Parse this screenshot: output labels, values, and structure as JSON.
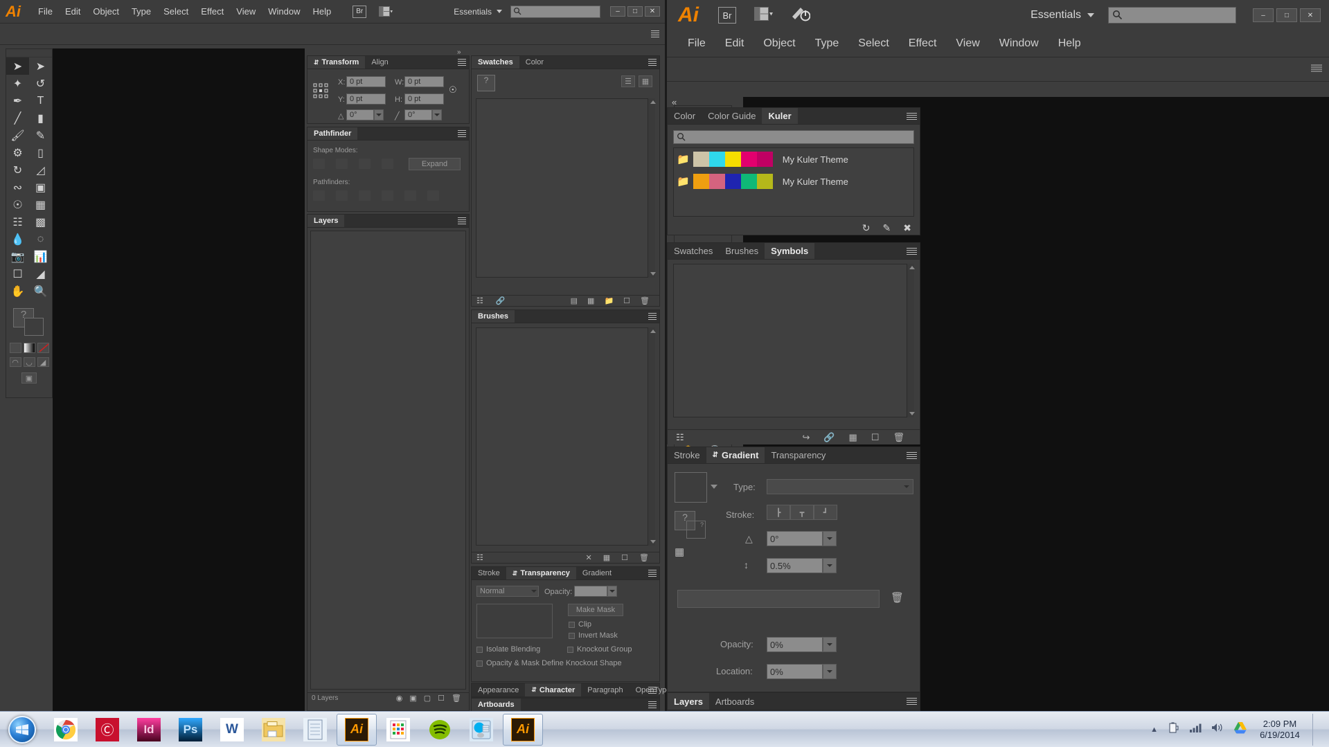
{
  "app": {
    "name": "Adobe Illustrator",
    "logo": "Ai"
  },
  "left_window": {
    "title": "",
    "menus": [
      "File",
      "Edit",
      "Object",
      "Type",
      "Select",
      "Effect",
      "View",
      "Window",
      "Help"
    ],
    "bridge_button": "Br",
    "arrange_icon": "arrange-documents-icon",
    "workspace": "Essentials",
    "search_placeholder": "",
    "window_controls": [
      "minimize",
      "maximize",
      "close"
    ],
    "panels": {
      "transform": {
        "tabs": [
          "Transform",
          "Align"
        ],
        "active_tab": "Transform",
        "fields": [
          {
            "label": "X:",
            "value": "0 pt"
          },
          {
            "label": "Y:",
            "value": "0 pt"
          },
          {
            "label": "W:",
            "value": "0 pt"
          },
          {
            "label": "H:",
            "value": "0 pt"
          }
        ],
        "shear_label": "0°",
        "rotate_label": "0°"
      },
      "pathfinder": {
        "tab": "Pathfinder",
        "shape_modes_label": "Shape Modes:",
        "pathfinders_label": "Pathfinders:",
        "expand_button": "Expand"
      },
      "layers": {
        "tab": "Layers",
        "status": "0 Layers"
      },
      "swatches": {
        "tabs": [
          "Swatches",
          "Color"
        ],
        "active_tab": "Swatches"
      },
      "brushes": {
        "tab": "Brushes"
      },
      "transparency": {
        "tabs": [
          "Stroke",
          "Transparency",
          "Gradient"
        ],
        "active_tab": "Transparency",
        "blend_mode": "Normal",
        "opacity_label": "Opacity:",
        "opacity_value": "",
        "make_mask_button": "Make Mask",
        "clip_label": "Clip",
        "invert_mask_label": "Invert Mask",
        "isolate_blending_label": "Isolate Blending",
        "knockout_group_label": "Knockout Group",
        "knockout_shape_label": "Opacity & Mask Define Knockout Shape"
      },
      "character": {
        "tabs": [
          "Appearance",
          "Character",
          "Paragraph",
          "OpenType"
        ],
        "active_tab": "Character"
      },
      "artboards": {
        "tab": "Artboards"
      }
    }
  },
  "right_window": {
    "menus": [
      "File",
      "Edit",
      "Object",
      "Type",
      "Select",
      "Effect",
      "View",
      "Window",
      "Help"
    ],
    "bridge_button": "Br",
    "arrange_icon": "arrange-documents-icon",
    "rocket_icon": "stock-icon",
    "workspace": "Essentials",
    "search_placeholder": "",
    "window_controls": [
      "minimize",
      "maximize",
      "close"
    ],
    "panels": {
      "kuler": {
        "tabs": [
          "Color",
          "Color Guide",
          "Kuler"
        ],
        "active_tab": "Kuler",
        "search_placeholder": "",
        "themes": [
          {
            "name": "My Kuler Theme",
            "colors": [
              "#cdc4a8",
              "#2fd8ec",
              "#f5dd00",
              "#e3006e",
              "#c00063"
            ]
          },
          {
            "name": "My Kuler Theme",
            "colors": [
              "#ef9f10",
              "#d4637f",
              "#1f24b0",
              "#0fb977",
              "#b5b81a"
            ]
          }
        ],
        "footer_icons": [
          "refresh-icon",
          "edit-theme-icon",
          "add-theme-icon"
        ]
      },
      "symbols": {
        "tabs": [
          "Swatches",
          "Brushes",
          "Symbols"
        ],
        "active_tab": "Symbols",
        "footer_icons": [
          "libraries-icon",
          "link-icon",
          "break-link-icon",
          "options-icon",
          "new-symbol-icon",
          "delete-icon"
        ]
      },
      "gradient": {
        "tabs": [
          "Stroke",
          "Gradient",
          "Transparency"
        ],
        "active_tab": "Gradient",
        "type_label": "Type:",
        "type_value": "",
        "stroke_label": "Stroke:",
        "angle_label": "0°",
        "aspect_label": "0.5%",
        "opacity_label": "Opacity:",
        "opacity_value": "0%",
        "location_label": "Location:",
        "location_value": "0%"
      },
      "layers": {
        "tabs": [
          "Layers",
          "Artboards"
        ],
        "active_tab": "Layers"
      }
    },
    "toolbox": {
      "rows": [
        [
          "selection-tool-icon",
          "direct-selection-tool-icon"
        ],
        [
          "magic-wand-tool-icon",
          "lasso-tool-icon"
        ],
        [
          "pen-tool-icon",
          "type-tool-icon"
        ],
        [
          "line-segment-tool-icon",
          "rectangle-tool-icon"
        ],
        [
          "paintbrush-tool-icon",
          "pencil-tool-icon"
        ],
        [
          "blob-brush-tool-icon",
          "eraser-tool-icon"
        ],
        [
          "rotate-tool-icon",
          "scale-tool-icon"
        ],
        [
          "width-tool-icon",
          "free-transform-tool-icon"
        ],
        [
          "shape-builder-tool-icon",
          "perspective-grid-tool-icon"
        ],
        [
          "mesh-tool-icon",
          "gradient-tool-icon"
        ],
        [
          "eyedropper-tool-icon",
          "blend-tool-icon"
        ],
        [
          "symbol-sprayer-tool-icon",
          "column-graph-tool-icon"
        ],
        [
          "artboard-tool-icon",
          "slice-tool-icon"
        ],
        [
          "hand-tool-icon",
          "zoom-tool-icon"
        ]
      ],
      "fill_stroke": "fill-stroke-swatch",
      "color_modes": [
        "color-icon",
        "gradient-icon",
        "none-icon"
      ],
      "draw_modes": [
        "draw-normal-icon",
        "draw-behind-icon",
        "draw-inside-icon"
      ],
      "screen_mode": "screen-mode-icon"
    }
  },
  "taskbar": {
    "start": "start-orb-icon",
    "items": [
      {
        "name": "chrome-icon",
        "label": "Google Chrome"
      },
      {
        "name": "creative-cloud-icon",
        "label": "Adobe Creative Cloud"
      },
      {
        "name": "indesign-icon",
        "label": "Id"
      },
      {
        "name": "photoshop-icon",
        "label": "Ps"
      },
      {
        "name": "word-icon",
        "label": "W"
      },
      {
        "name": "explorer-icon",
        "label": "Windows Explorer"
      },
      {
        "name": "notepad-icon",
        "label": "Notepad"
      },
      {
        "name": "illustrator-icon",
        "label": "Ai"
      },
      {
        "name": "calculator-icon",
        "label": "Calculator"
      },
      {
        "name": "spotify-icon",
        "label": "Spotify"
      },
      {
        "name": "skype-icon",
        "label": "Skype"
      },
      {
        "name": "illustrator2-icon",
        "label": "Ai"
      }
    ],
    "tray": [
      "show-hidden-icons-icon",
      "battery-icon",
      "network-icon",
      "volume-icon",
      "google-drive-icon"
    ],
    "clock_time": "2:09 PM",
    "clock_date": "6/19/2014"
  },
  "colors": {
    "panel_bg": "#3d3d3d",
    "chrome_bg": "#3c3c3c",
    "canvas": "#101010",
    "accent": "#ef8200",
    "field_bg": "#8c8c8c"
  }
}
